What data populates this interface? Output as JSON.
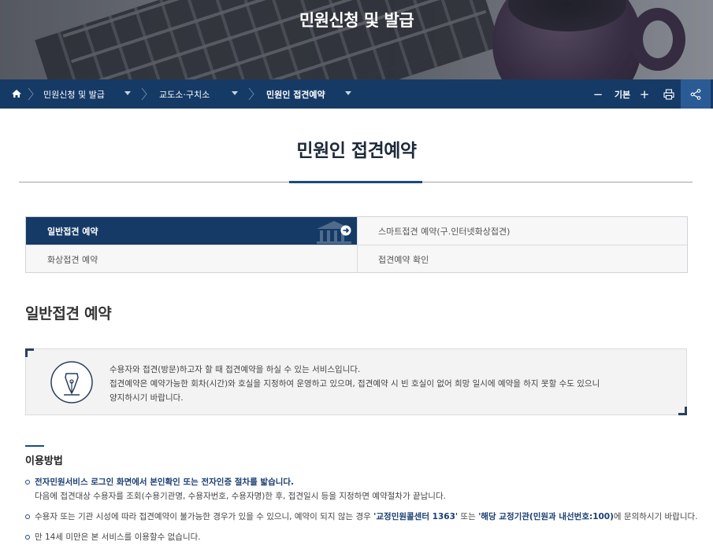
{
  "hero": {
    "title": "민원신청 및 발급"
  },
  "location": {
    "crumbs": [
      {
        "label": "민원신청 및 발급"
      },
      {
        "label": "교도소·구치소"
      },
      {
        "label": "민원인 접견예약"
      }
    ],
    "zoom_minus": "−",
    "zoom_label": "기본",
    "zoom_plus": "+"
  },
  "page": {
    "title": "민원인 접견예약",
    "tabs": [
      {
        "label": "일반접견 예약",
        "active": true
      },
      {
        "label": "스마트접견 예약(구.인터넷화상접견)",
        "active": false
      },
      {
        "label": "화상접견 예약",
        "active": false
      },
      {
        "label": "접견예약 확인",
        "active": false
      }
    ],
    "section_heading": "일반접견 예약",
    "info_lines": [
      "수용자와 접견(방문)하고자 할 때 접견예약을 하실 수 있는 서비스입니다.",
      "접견예약은 예약가능한 회차(시간)와 호실을 지정하여 운영하고 있으며, 접견예약 시 빈 호실이 없어 희망 일시에 예약을 하지 못할 수도 있으니",
      "양지하시기 바랍니다."
    ],
    "usage": {
      "heading": "이용방법",
      "item1_strong": "전자민원서비스 로그인 화면에서 본인확인 또는 전자인증 절차를 밟습니다.",
      "item1_sub": "다음에 접견대상 수용자를 조회(수용기관명, 수용자번호, 수용자명)한 후, 접견일시 등을 지정하면 예약절차가 끝납니다.",
      "item2_pre": "수용자 또는 기관 시성에 따라 접견예약이 불가능한 경우가 있을 수 있으니, 예약이 되지 않는 경우 ",
      "item2_hl1": "'교정민원콜센터 1363'",
      "item2_mid": " 또는 ",
      "item2_hl2": "'해당 교정기관(민원과 내선번호:100)",
      "item2_post": "에 문의하시기 바랍니다.",
      "item3": "만 14세 미만은 본 서비스를 이용할수 없습니다."
    }
  },
  "colors": {
    "navy": "#153a66",
    "accent": "#1a4a80",
    "share_bg": "#2a5b94"
  },
  "icons": [
    "home-icon",
    "chevron-right-icon",
    "caret-down-icon",
    "print-icon",
    "share-icon",
    "arrow-right-circle-icon",
    "fountain-pen-icon"
  ]
}
